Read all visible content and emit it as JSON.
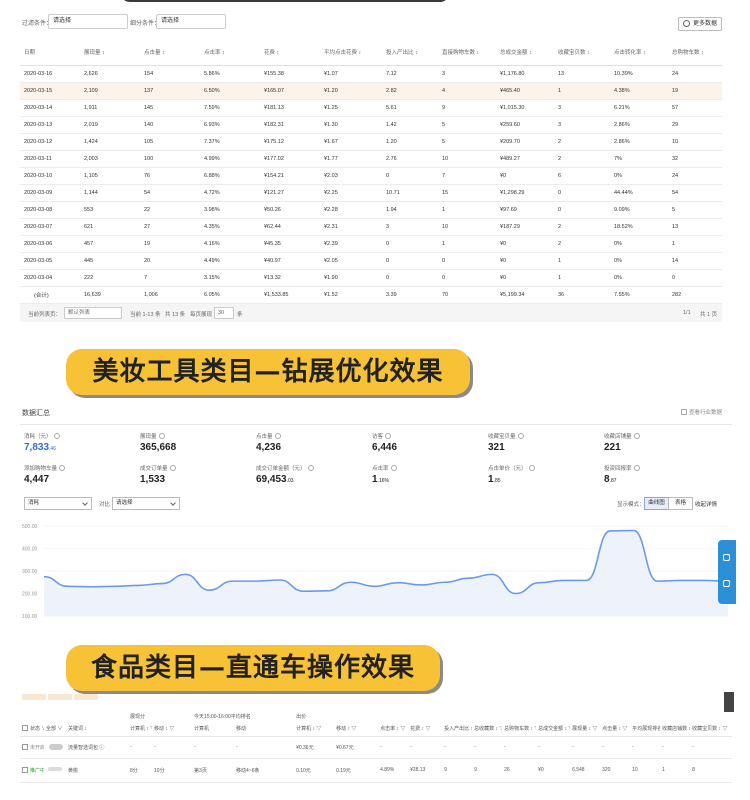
{
  "panel1": {
    "filter1_label": "过滤条件：",
    "filter1_value": "请选择",
    "filter2_label": "细分条件：",
    "filter2_value": "请选择",
    "more_data": "更多数据",
    "columns": [
      "日期",
      "展现量 ↕",
      "点击量 ↕",
      "点击率 ↕",
      "花费 ↕",
      "平均点击花费 ↕",
      "投入产出比 ↕",
      "直接购物车数 ↕",
      "总成交金额 ↕",
      "收藏宝贝数 ↕",
      "点击转化率 ↕",
      "总购物车数 ↕"
    ],
    "rows": [
      [
        "2020-03-16",
        "2,626",
        "154",
        "5.86%",
        "¥155.38",
        "¥1.07",
        "7.12",
        "3",
        "¥1,176.80",
        "13",
        "10.39%",
        "24"
      ],
      [
        "2020-03-15",
        "2,109",
        "137",
        "6.50%",
        "¥165.07",
        "¥1.20",
        "2.82",
        "4",
        "¥465.40",
        "1",
        "4.38%",
        "19"
      ],
      [
        "2020-03-14",
        "1,911",
        "145",
        "7.59%",
        "¥181.13",
        "¥1.25",
        "5.61",
        "9",
        "¥1,015.30",
        "3",
        "6.21%",
        "57"
      ],
      [
        "2020-03-13",
        "2,019",
        "140",
        "6.93%",
        "¥182.31",
        "¥1.30",
        "1.42",
        "5",
        "¥259.60",
        "3",
        "2.86%",
        "29"
      ],
      [
        "2020-03-12",
        "1,424",
        "105",
        "7.37%",
        "¥175.12",
        "¥1.67",
        "1.20",
        "5",
        "¥209.70",
        "2",
        "2.86%",
        "10"
      ],
      [
        "2020-03-11",
        "2,003",
        "100",
        "4.99%",
        "¥177.02",
        "¥1.77",
        "2.76",
        "10",
        "¥489.27",
        "2",
        "7%",
        "32"
      ],
      [
        "2020-03-10",
        "1,105",
        "76",
        "6.88%",
        "¥154.21",
        "¥2.03",
        "0",
        "7",
        "¥0",
        "6",
        "0%",
        "24"
      ],
      [
        "2020-03-09",
        "1,144",
        "54",
        "4.72%",
        "¥121.27",
        "¥2.25",
        "10.71",
        "15",
        "¥1,298.29",
        "0",
        "44.44%",
        "54"
      ],
      [
        "2020-03-08",
        "553",
        "22",
        "3.98%",
        "¥50.26",
        "¥2.28",
        "1.94",
        "1",
        "¥97.69",
        "0",
        "9.09%",
        "5"
      ],
      [
        "2020-03-07",
        "621",
        "27",
        "4.35%",
        "¥62.44",
        "¥2.31",
        "3",
        "10",
        "¥187.29",
        "2",
        "18.52%",
        "13"
      ],
      [
        "2020-03-06",
        "457",
        "19",
        "4.16%",
        "¥45.35",
        "¥2.39",
        "0",
        "1",
        "¥0",
        "2",
        "0%",
        "1"
      ],
      [
        "2020-03-05",
        "445",
        "20",
        "4.49%",
        "¥40.97",
        "¥2.05",
        "0",
        "0",
        "¥0",
        "1",
        "0%",
        "14"
      ],
      [
        "2020-03-04",
        "222",
        "7",
        "3.15%",
        "¥13.32",
        "¥1.90",
        "0",
        "0",
        "¥0",
        "1",
        "0%",
        "0"
      ]
    ],
    "total": [
      "(合计)",
      "16,639",
      "1,006",
      "6.05%",
      "¥1,533.85",
      "¥1.52",
      "3.39",
      "70",
      "¥5,199.34",
      "36",
      "7.55%",
      "282"
    ],
    "pager": {
      "list_label": "当前列表页：",
      "list_value": "默认列表",
      "range": "当前 1-13 条",
      "total": "共 13 条",
      "per_page_label": "每页展现",
      "per_page": "30",
      "per_page_unit": "条",
      "page_info": "1/1",
      "page_total": "共 1 页"
    }
  },
  "banner1": "美妆工具类目—钻展优化效果",
  "banner2": "食品类目—直通车操作效果",
  "panel2": {
    "title": "数据汇总",
    "industry_check": "查看行业数据",
    "metrics": [
      {
        "label": "消耗（元）",
        "value": "7,833",
        "decimal": ".46",
        "blue": true
      },
      {
        "label": "展现量",
        "value": "365,668",
        "decimal": "",
        "blue": false
      },
      {
        "label": "点击量",
        "value": "4,236",
        "decimal": "",
        "blue": false
      },
      {
        "label": "访客",
        "value": "6,446",
        "decimal": "",
        "blue": false
      },
      {
        "label": "收藏宝贝量",
        "value": "321",
        "decimal": "",
        "blue": false
      },
      {
        "label": "收藏店铺量",
        "value": "221",
        "decimal": "",
        "blue": false
      },
      {
        "label": "添加购物车量",
        "value": "4,447",
        "decimal": "",
        "blue": false
      },
      {
        "label": "成交订单量",
        "value": "1,533",
        "decimal": "",
        "blue": false
      },
      {
        "label": "成交订单金额（元）",
        "value": "69,453",
        "decimal": ".03",
        "blue": false
      },
      {
        "label": "点击率",
        "value": "1",
        "decimal": ".16%",
        "blue": false
      },
      {
        "label": "点击单价（元）",
        "value": "1",
        "decimal": ".85",
        "blue": false
      },
      {
        "label": "投资回报率",
        "value": "8",
        "decimal": ".87",
        "blue": false
      }
    ],
    "select1": "消耗",
    "vs": "对比",
    "select2": "请选择",
    "mode_label": "显示模式：",
    "mode_chart": "曲线图",
    "mode_table": "表格",
    "collapse": "收起详情"
  },
  "panel3": {
    "header1": [
      "",
      "",
      "展现分",
      "今天15:00-16:00平均排名",
      "出价",
      ""
    ],
    "col_headers": [
      "状态 ∨",
      "全部 ∨",
      "关键词 ↕",
      "计算机 ↕ ▽",
      "移动 ↕ ▽",
      "计算机",
      "移动",
      "计算机 ↕ ▽",
      "移动 ↕ ▽",
      "点击率 ↕ ▽",
      "花费 ↕ ▽",
      "投入产出比 ↕ ▽",
      "总收藏数 ↕ ▽",
      "总购物车数 ↕ ▽",
      "总成交金额 ↕ ▽",
      "展现量 ↕ ▽",
      "点击量 ↕ ▽",
      "平均展现排名 ↕ ▽",
      "收藏店铺数 ↕ ▽",
      "收藏宝贝数 ↕ ▽"
    ],
    "row1": [
      "未开启",
      "",
      "流量智选词包 ⓘ",
      "-",
      "-",
      "-",
      "-",
      "¥0.36元",
      "¥0.67元",
      "-",
      "-",
      "-",
      "-",
      "-",
      "-",
      "-",
      "-",
      "-",
      "-",
      "-"
    ],
    "row2": [
      "推广中",
      "",
      "黄桃",
      "8分",
      "10分",
      "第3页",
      "移动4~6条",
      "0.10元",
      "0.19元",
      "4.89%",
      "¥28.13",
      "9",
      "9",
      "26",
      "¥0",
      "6,548",
      "320",
      "10",
      "1",
      "8"
    ]
  },
  "chart_data": {
    "type": "line",
    "ylim": [
      100,
      500
    ],
    "yticks": [
      "500.00",
      "400.00",
      "300.00",
      "200.00",
      "100.00"
    ],
    "series": [
      {
        "values": [
          275,
          232,
          230,
          232,
          236,
          244,
          285,
          215,
          255,
          255,
          260,
          210,
          212,
          250,
          232,
          248,
          238,
          250,
          268,
          285,
          200,
          248,
          258,
          258,
          478,
          480,
          255,
          258,
          258,
          255
        ]
      }
    ]
  }
}
